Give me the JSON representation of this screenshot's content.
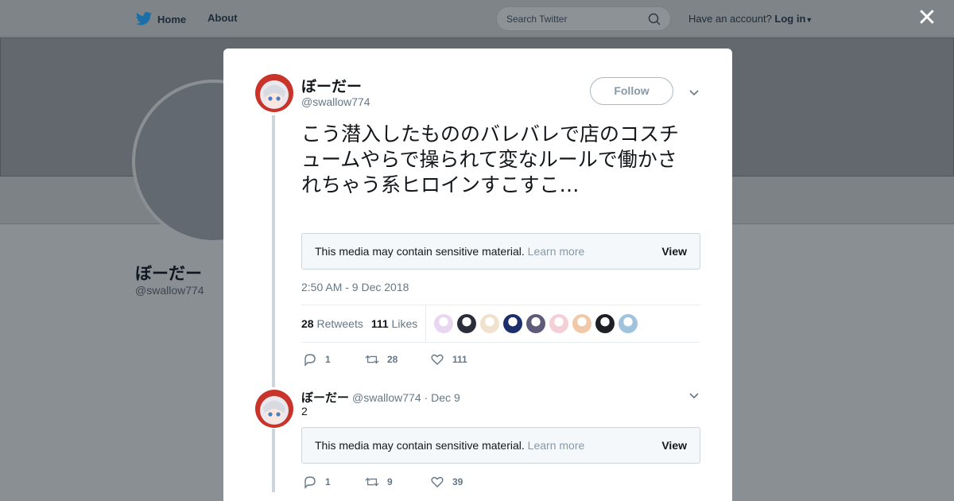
{
  "nav": {
    "home_label": "Home",
    "about_label": "About",
    "search_placeholder": "Search Twitter",
    "account_text": "Have an account?",
    "login_label": "Log in"
  },
  "profile": {
    "name": "ぼーだー",
    "handle": "@swallow774"
  },
  "tweet": {
    "author_name": "ぼーだー",
    "author_handle": "@swallow774",
    "follow_label": "Follow",
    "text": "こう潜入したもののバレバレで店のコスチュームやらで操られて変なルールで働かされちゃう系ヒロインすこすこ…",
    "sensitive": {
      "message": "This media may contain sensitive material.",
      "learn_more": "Learn more",
      "view": "View"
    },
    "timestamp": "2:50 AM - 9 Dec 2018",
    "retweets_count": "28",
    "retweets_label": "Retweets",
    "likes_count": "111",
    "likes_label": "Likes",
    "actions": {
      "replies": "1",
      "retweets": "28",
      "likes": "111"
    },
    "liker_colors": [
      "#e9d7f2",
      "#2b2d3a",
      "#f1e2cf",
      "#1d2f6b",
      "#5e5a7a",
      "#f4cfd8",
      "#f2c9a8",
      "#1f2024",
      "#9fc2dd"
    ]
  },
  "reply": {
    "author_name": "ぼーだー",
    "author_handle": "@swallow774",
    "date": "· Dec 9",
    "text": "2",
    "sensitive": {
      "message": "This media may contain sensitive material.",
      "learn_more": "Learn more",
      "view": "View"
    },
    "actions": {
      "replies": "1",
      "retweets": "9",
      "likes": "39"
    }
  },
  "colors": {
    "accent": "#1da1f2",
    "overlay": "#8a8f93",
    "muted": "#657786"
  }
}
